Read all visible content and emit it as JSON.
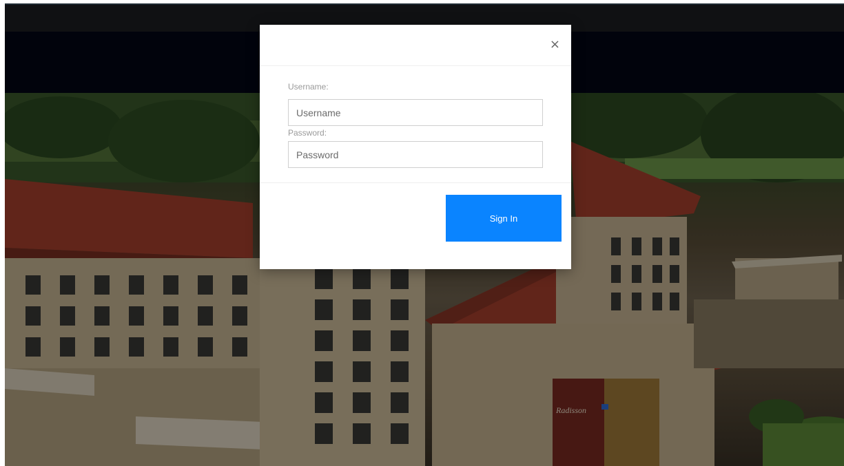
{
  "modal": {
    "close_glyph": "×",
    "username_label": "Username:",
    "username_placeholder": "Username",
    "username_value": "",
    "password_label": "Password:",
    "password_placeholder": "Password",
    "password_value": "",
    "signin_label": "Sign In"
  },
  "background": {
    "sign_text": "Radisson"
  },
  "colors": {
    "accent": "#0a84ff",
    "topbar": "#101113",
    "navband": "#01030c",
    "roof": "#a8412e",
    "facade": "#cdbb9a"
  }
}
